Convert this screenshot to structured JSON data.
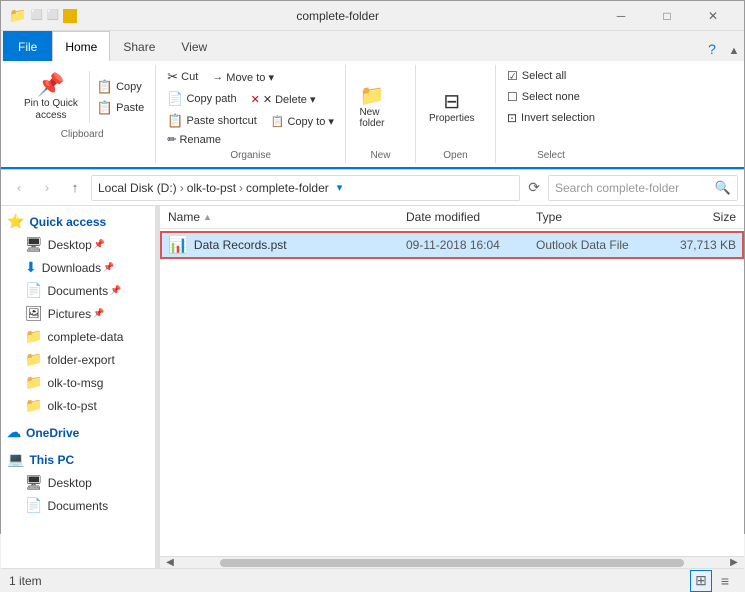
{
  "titleBar": {
    "folderIcon": "📁",
    "quickIcons": [
      "⬜",
      "⬜",
      "⬜"
    ],
    "title": "complete-folder",
    "minimize": "─",
    "maximize": "□",
    "close": "✕"
  },
  "ribbon": {
    "tabs": [
      {
        "label": "File",
        "class": "file"
      },
      {
        "label": "Home",
        "class": "active"
      },
      {
        "label": "Share",
        "class": ""
      },
      {
        "label": "View",
        "class": ""
      }
    ],
    "clipboard": {
      "groupLabel": "Clipboard",
      "pin": {
        "icon": "📌",
        "label": "Pin to Quick\naccess"
      },
      "copy": {
        "icon": "📋",
        "label": "Copy"
      },
      "cut": {
        "icon": "✂",
        "label": "Cut"
      },
      "copyPath": {
        "icon": "📄",
        "label": "Copy path"
      },
      "paste": {
        "icon": "📋",
        "label": "Paste"
      },
      "pasteShortcut": {
        "icon": "📋",
        "label": "Paste shortcut"
      }
    },
    "organise": {
      "groupLabel": "Organise",
      "moveTo": "Move to ▾",
      "delete": "✕ Delete ▾",
      "copyTo": "Copy to ▾",
      "rename": "Rename"
    },
    "new": {
      "groupLabel": "New",
      "newFolder": {
        "icon": "📁",
        "label": "New\nfolder"
      }
    },
    "open": {
      "groupLabel": "Open",
      "properties": {
        "icon": "ℹ",
        "label": "Properties"
      }
    },
    "select": {
      "groupLabel": "Select",
      "selectAll": "Select all",
      "selectNone": "Select none",
      "invertSelection": "Invert selection"
    }
  },
  "addressBar": {
    "back": "‹",
    "forward": "›",
    "up": "↑",
    "path": [
      {
        "label": "Local Disk (D:)",
        "sep": "›"
      },
      {
        "label": "olk-to-pst",
        "sep": "›"
      },
      {
        "label": "complete-folder",
        "sep": ""
      }
    ],
    "refresh": "⟳",
    "searchPlaceholder": "Search complete-folder",
    "searchIcon": "🔍"
  },
  "sidebar": {
    "items": [
      {
        "icon": "⭐",
        "label": "Quick access",
        "type": "group"
      },
      {
        "icon": "🖥",
        "label": "Desktop",
        "type": "item",
        "pinned": true
      },
      {
        "icon": "⬇",
        "label": "Downloads",
        "type": "item",
        "pinned": true
      },
      {
        "icon": "📄",
        "label": "Documents",
        "type": "item",
        "pinned": true
      },
      {
        "icon": "🖼",
        "label": "Pictures",
        "type": "item",
        "pinned": true
      },
      {
        "icon": "📁",
        "label": "complete-data",
        "type": "item"
      },
      {
        "icon": "📁",
        "label": "folder-export",
        "type": "item"
      },
      {
        "icon": "📁",
        "label": "olk-to-msg",
        "type": "item"
      },
      {
        "icon": "📁",
        "label": "olk-to-pst",
        "type": "item"
      },
      {
        "icon": "☁",
        "label": "OneDrive",
        "type": "group"
      },
      {
        "icon": "💻",
        "label": "This PC",
        "type": "group"
      },
      {
        "icon": "🖥",
        "label": "Desktop",
        "type": "item-sub"
      },
      {
        "icon": "📄",
        "label": "Documents",
        "type": "item-sub"
      }
    ]
  },
  "fileList": {
    "columns": [
      {
        "label": "Name",
        "sort": "▲"
      },
      {
        "label": "Date modified"
      },
      {
        "label": "Type"
      },
      {
        "label": "Size"
      }
    ],
    "files": [
      {
        "icon": "📊",
        "name": "Data Records.pst",
        "dateModified": "09-11-2018 16:04",
        "type": "Outlook Data File",
        "size": "37,713 KB",
        "selected": true
      }
    ]
  },
  "statusBar": {
    "text": "1 item",
    "viewDetails": "⊞",
    "viewList": "≡"
  }
}
